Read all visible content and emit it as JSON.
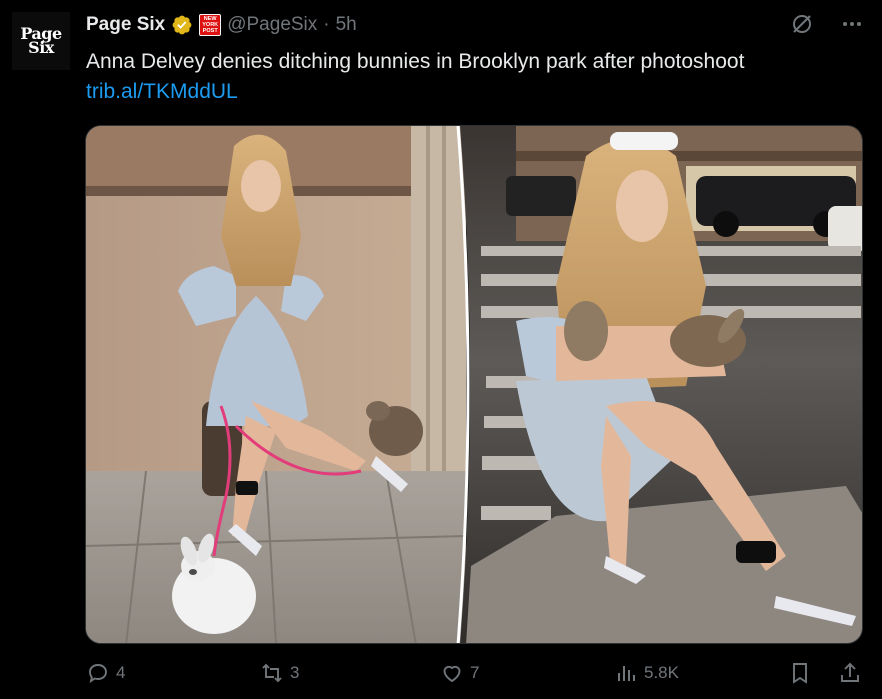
{
  "account": {
    "avatar_line1": "Page",
    "avatar_line2": "Six",
    "name": "Page Six",
    "affiliate_badge_text": "NEW YORK POST",
    "handle": "@PageSix",
    "separator": "·",
    "time": "5h"
  },
  "tweet": {
    "text": "Anna Delvey denies ditching bunnies in Brooklyn park after photoshoot",
    "link": "trib.al/TKMddUL"
  },
  "icons": {
    "verified": "verified-badge-icon",
    "grok": "grok-icon",
    "more": "more-icon"
  },
  "actions": {
    "replies": "4",
    "reposts": "3",
    "likes": "7",
    "views": "5.8K"
  },
  "colors": {
    "accent": "#1d9bf0",
    "verified_gold": "#e2b719",
    "muted": "#71767b"
  }
}
